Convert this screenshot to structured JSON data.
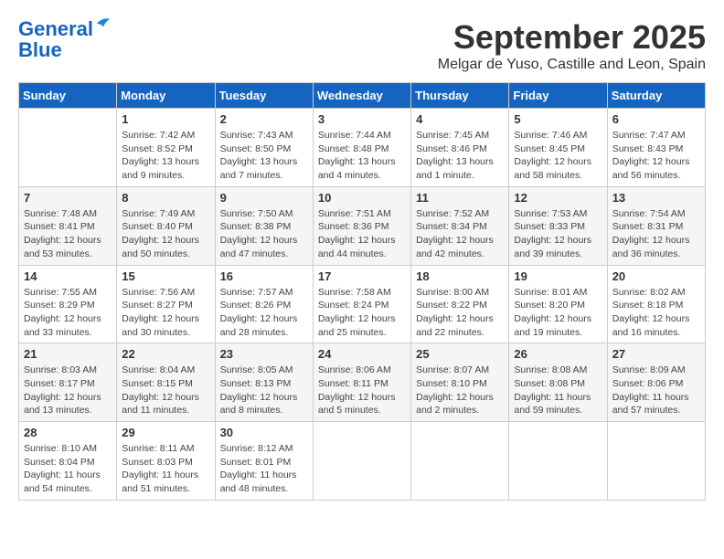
{
  "logo": {
    "line1": "General",
    "line2": "Blue"
  },
  "title": "September 2025",
  "subtitle": "Melgar de Yuso, Castille and Leon, Spain",
  "headers": [
    "Sunday",
    "Monday",
    "Tuesday",
    "Wednesday",
    "Thursday",
    "Friday",
    "Saturday"
  ],
  "weeks": [
    [
      {
        "day": "",
        "info": ""
      },
      {
        "day": "1",
        "info": "Sunrise: 7:42 AM\nSunset: 8:52 PM\nDaylight: 13 hours\nand 9 minutes."
      },
      {
        "day": "2",
        "info": "Sunrise: 7:43 AM\nSunset: 8:50 PM\nDaylight: 13 hours\nand 7 minutes."
      },
      {
        "day": "3",
        "info": "Sunrise: 7:44 AM\nSunset: 8:48 PM\nDaylight: 13 hours\nand 4 minutes."
      },
      {
        "day": "4",
        "info": "Sunrise: 7:45 AM\nSunset: 8:46 PM\nDaylight: 13 hours\nand 1 minute."
      },
      {
        "day": "5",
        "info": "Sunrise: 7:46 AM\nSunset: 8:45 PM\nDaylight: 12 hours\nand 58 minutes."
      },
      {
        "day": "6",
        "info": "Sunrise: 7:47 AM\nSunset: 8:43 PM\nDaylight: 12 hours\nand 56 minutes."
      }
    ],
    [
      {
        "day": "7",
        "info": "Sunrise: 7:48 AM\nSunset: 8:41 PM\nDaylight: 12 hours\nand 53 minutes."
      },
      {
        "day": "8",
        "info": "Sunrise: 7:49 AM\nSunset: 8:40 PM\nDaylight: 12 hours\nand 50 minutes."
      },
      {
        "day": "9",
        "info": "Sunrise: 7:50 AM\nSunset: 8:38 PM\nDaylight: 12 hours\nand 47 minutes."
      },
      {
        "day": "10",
        "info": "Sunrise: 7:51 AM\nSunset: 8:36 PM\nDaylight: 12 hours\nand 44 minutes."
      },
      {
        "day": "11",
        "info": "Sunrise: 7:52 AM\nSunset: 8:34 PM\nDaylight: 12 hours\nand 42 minutes."
      },
      {
        "day": "12",
        "info": "Sunrise: 7:53 AM\nSunset: 8:33 PM\nDaylight: 12 hours\nand 39 minutes."
      },
      {
        "day": "13",
        "info": "Sunrise: 7:54 AM\nSunset: 8:31 PM\nDaylight: 12 hours\nand 36 minutes."
      }
    ],
    [
      {
        "day": "14",
        "info": "Sunrise: 7:55 AM\nSunset: 8:29 PM\nDaylight: 12 hours\nand 33 minutes."
      },
      {
        "day": "15",
        "info": "Sunrise: 7:56 AM\nSunset: 8:27 PM\nDaylight: 12 hours\nand 30 minutes."
      },
      {
        "day": "16",
        "info": "Sunrise: 7:57 AM\nSunset: 8:26 PM\nDaylight: 12 hours\nand 28 minutes."
      },
      {
        "day": "17",
        "info": "Sunrise: 7:58 AM\nSunset: 8:24 PM\nDaylight: 12 hours\nand 25 minutes."
      },
      {
        "day": "18",
        "info": "Sunrise: 8:00 AM\nSunset: 8:22 PM\nDaylight: 12 hours\nand 22 minutes."
      },
      {
        "day": "19",
        "info": "Sunrise: 8:01 AM\nSunset: 8:20 PM\nDaylight: 12 hours\nand 19 minutes."
      },
      {
        "day": "20",
        "info": "Sunrise: 8:02 AM\nSunset: 8:18 PM\nDaylight: 12 hours\nand 16 minutes."
      }
    ],
    [
      {
        "day": "21",
        "info": "Sunrise: 8:03 AM\nSunset: 8:17 PM\nDaylight: 12 hours\nand 13 minutes."
      },
      {
        "day": "22",
        "info": "Sunrise: 8:04 AM\nSunset: 8:15 PM\nDaylight: 12 hours\nand 11 minutes."
      },
      {
        "day": "23",
        "info": "Sunrise: 8:05 AM\nSunset: 8:13 PM\nDaylight: 12 hours\nand 8 minutes."
      },
      {
        "day": "24",
        "info": "Sunrise: 8:06 AM\nSunset: 8:11 PM\nDaylight: 12 hours\nand 5 minutes."
      },
      {
        "day": "25",
        "info": "Sunrise: 8:07 AM\nSunset: 8:10 PM\nDaylight: 12 hours\nand 2 minutes."
      },
      {
        "day": "26",
        "info": "Sunrise: 8:08 AM\nSunset: 8:08 PM\nDaylight: 11 hours\nand 59 minutes."
      },
      {
        "day": "27",
        "info": "Sunrise: 8:09 AM\nSunset: 8:06 PM\nDaylight: 11 hours\nand 57 minutes."
      }
    ],
    [
      {
        "day": "28",
        "info": "Sunrise: 8:10 AM\nSunset: 8:04 PM\nDaylight: 11 hours\nand 54 minutes."
      },
      {
        "day": "29",
        "info": "Sunrise: 8:11 AM\nSunset: 8:03 PM\nDaylight: 11 hours\nand 51 minutes."
      },
      {
        "day": "30",
        "info": "Sunrise: 8:12 AM\nSunset: 8:01 PM\nDaylight: 11 hours\nand 48 minutes."
      },
      {
        "day": "",
        "info": ""
      },
      {
        "day": "",
        "info": ""
      },
      {
        "day": "",
        "info": ""
      },
      {
        "day": "",
        "info": ""
      }
    ]
  ]
}
